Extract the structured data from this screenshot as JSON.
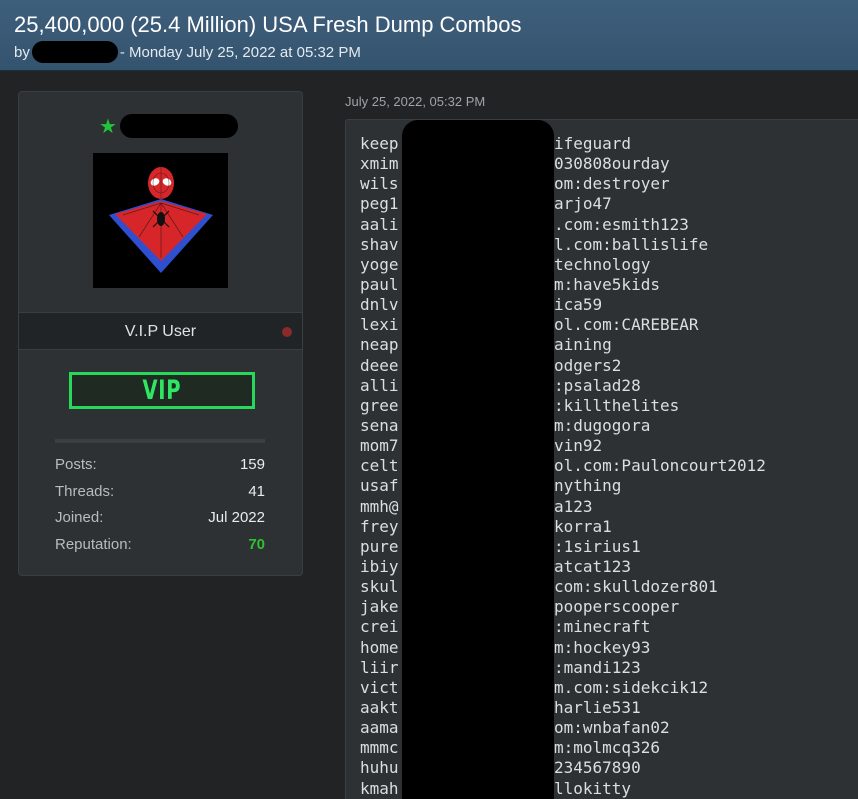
{
  "thread": {
    "title": "25,400,000 (25.4 Million) USA Fresh Dump Combos",
    "by_label": "by",
    "meta_date": "- Monday July 25, 2022 at 05:32 PM"
  },
  "user": {
    "rank": "V.I.P User",
    "badge": "VIP",
    "stats": [
      {
        "label": "Posts:",
        "value": "159"
      },
      {
        "label": "Threads:",
        "value": "41"
      },
      {
        "label": "Joined:",
        "value": "Jul 2022"
      },
      {
        "label": "Reputation:",
        "value": "70"
      }
    ],
    "colors": {
      "online_star": "#22c43a",
      "reputation": "#2fbf2f",
      "vip_border": "#27d85a"
    }
  },
  "post": {
    "date": "July 25, 2022, 05:32 PM",
    "lines": [
      {
        "pre": "keep",
        "post": "ifeguard"
      },
      {
        "pre": "xmim",
        "post": "030808ourday"
      },
      {
        "pre": "wils",
        "post": "om:destroyer"
      },
      {
        "pre": "peg1",
        "post": "arjo47"
      },
      {
        "pre": "aali",
        "post": ".com:esmith123"
      },
      {
        "pre": "shav",
        "post": "l.com:ballislife"
      },
      {
        "pre": "yoge",
        "post": "technology"
      },
      {
        "pre": "paul",
        "post": "m:have5kids"
      },
      {
        "pre": "dnlv",
        "post": "ica59"
      },
      {
        "pre": "lexi",
        "post": "ol.com:CAREBEAR"
      },
      {
        "pre": "neap",
        "post": "aining"
      },
      {
        "pre": "deee",
        "post": "odgers2"
      },
      {
        "pre": "alli",
        "post": ":psalad28"
      },
      {
        "pre": "gree",
        "post": ":killthelites"
      },
      {
        "pre": "sena",
        "post": "m:dugogora"
      },
      {
        "pre": "mom7",
        "post": "vin92"
      },
      {
        "pre": "celt",
        "post": "ol.com:Pauloncourt2012"
      },
      {
        "pre": "usaf",
        "post": "nything"
      },
      {
        "pre": "mmh@",
        "post": "a123"
      },
      {
        "pre": "frey",
        "post": "korra1"
      },
      {
        "pre": "pure",
        "post": ":1sirius1"
      },
      {
        "pre": "ibiy",
        "post": "atcat123"
      },
      {
        "pre": "skul",
        "post": "com:skulldozer801"
      },
      {
        "pre": "jake",
        "post": "pooperscooper"
      },
      {
        "pre": "crei",
        "post": ":minecraft"
      },
      {
        "pre": "home",
        "post": "m:hockey93"
      },
      {
        "pre": "liir",
        "post": ":mandi123"
      },
      {
        "pre": "vict",
        "post": "m.com:sidekcik12"
      },
      {
        "pre": "aakt",
        "post": "harlie531"
      },
      {
        "pre": "aama",
        "post": "om:wnbafan02"
      },
      {
        "pre": "mmmc",
        "post": "m:molmcq326"
      },
      {
        "pre": "huhu",
        "post": "234567890"
      },
      {
        "pre": "kmah",
        "post": "llokitty"
      }
    ]
  }
}
